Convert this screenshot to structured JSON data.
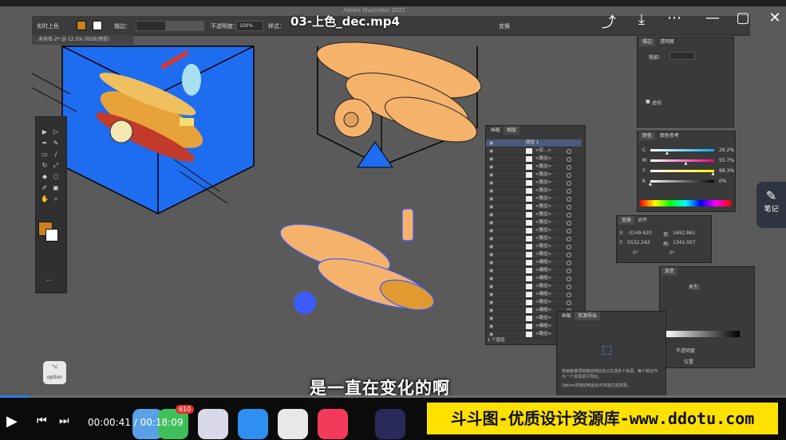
{
  "video": {
    "title": "03-上色_dec.mp4",
    "subtitle": "是一直在变化的啊",
    "time_current": "00:00:41",
    "time_total": "00:18:09",
    "progress": 0.038,
    "watermark": "斗斗图-优质设计资源库-www.ddotu.com",
    "notes_label": "笔记",
    "badge_count": "610"
  },
  "app": {
    "title": "Adobe Illustrator 2021",
    "doc_tab": "未命名-2* @ 12.5% (RGB/预览)",
    "option_key": "option"
  },
  "control_bar": {
    "fill_label": "实时上色",
    "stroke_label": "描边：",
    "opacity_label": "不透明度：",
    "opacity_value": "100%",
    "style_label": "样式：",
    "transform_label": "变换"
  },
  "layers_panel": {
    "tabs": [
      "画板",
      "图层"
    ],
    "top_layer": "图层 1",
    "rows": [
      "<实...>",
      "<路径>",
      "<路径>",
      "<路径>",
      "<路径>",
      "<路径>",
      "<路径>",
      "<路径>",
      "<路径>",
      "<路径>",
      "<路径>",
      "<路径>",
      "<路径>",
      "<路径>",
      "<编组>",
      "<编组>",
      "<编组>",
      "<路径>",
      "<编组>",
      "<路径>",
      "<编组>",
      "<路径>",
      "<编组>",
      "<路径>"
    ],
    "footer": "1 个图层"
  },
  "stroke_panel": {
    "tabs": [
      "描边",
      "透明度"
    ],
    "weight_label": "粗细：",
    "dashed_label": "虚线"
  },
  "color_panel": {
    "tabs": [
      "颜色",
      "颜色参考"
    ],
    "channels": [
      {
        "name": "C",
        "value": "26.2",
        "unit": "%",
        "fraction": 0.262
      },
      {
        "name": "M",
        "value": "55.7",
        "unit": "%",
        "fraction": 0.557
      },
      {
        "name": "Y",
        "value": "98.3",
        "unit": "%",
        "fraction": 0.983
      },
      {
        "name": "K",
        "value": "0",
        "unit": "%",
        "fraction": 0.0
      }
    ]
  },
  "transform_panel": {
    "tabs": [
      "变换",
      "对齐"
    ],
    "x_label": "X:",
    "x_value": "-3149.620",
    "y_label": "Y:",
    "y_value": "5532.242",
    "w_label": "宽:",
    "w_value": "1692.861",
    "h_label": "高:",
    "h_value": "1341.007",
    "angle1": "0°",
    "angle2": "0°"
  },
  "gradient_panel": {
    "tab": "渐变",
    "type_label": "类型：",
    "opacity_label": "不透明度",
    "position_label": "位置"
  },
  "asset_panel": {
    "tabs": [
      "画板",
      "资源导出"
    ],
    "help_text": "将画板或项目拖动到此处以生成多个资源。每个组合作为一个资源进行导出。",
    "help_text2": "Option并拖动到此处可单独生成资源。"
  },
  "colors": {
    "canvas_bg": "#5a5a5a",
    "artboard_blue": "#1e6cf0",
    "plane_orange": "#f5b26b",
    "accent_fill": "#c9821e",
    "watermark_yellow": "#ffe100",
    "selection_blue": "#3a5cff"
  },
  "icons": [
    "share-icon",
    "download-icon",
    "more-icon",
    "minimize-icon",
    "maximize-icon",
    "close-icon",
    "play-icon",
    "prev-icon",
    "next-icon",
    "notes-icon"
  ]
}
